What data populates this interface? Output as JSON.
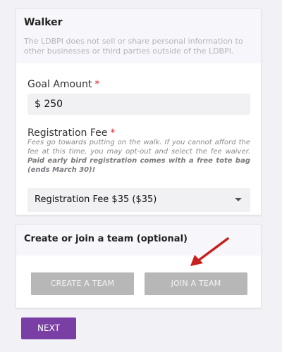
{
  "walker_card": {
    "title": "Walker",
    "privacy_note": "The LDBPI does not sell or share personal information to other businesses or third parties outside of the LDBPI."
  },
  "goal": {
    "label": "Goal Amount",
    "required_mark": "*",
    "value": "$ 250"
  },
  "fee": {
    "label": "Registration Fee",
    "required_mark": "*",
    "help_text": "Fees go towards putting on the walk. If you cannot afford the fee at this time, you may opt-out and select the fee waiver.",
    "help_bold": "Paid early bird registration comes with a free tote bag (ends March 30)!",
    "selected_option": "Registration Fee $35 ($35)"
  },
  "team_card": {
    "title": "Create or join a team (optional)",
    "create_label": "CREATE A TEAM",
    "join_label": "JOIN A TEAM"
  },
  "next_label": "NEXT",
  "colors": {
    "accent_purple": "#7a3fa4",
    "required_red": "#d9242a",
    "arrow_red": "#c8201e",
    "button_gray": "#b7b7b7"
  }
}
